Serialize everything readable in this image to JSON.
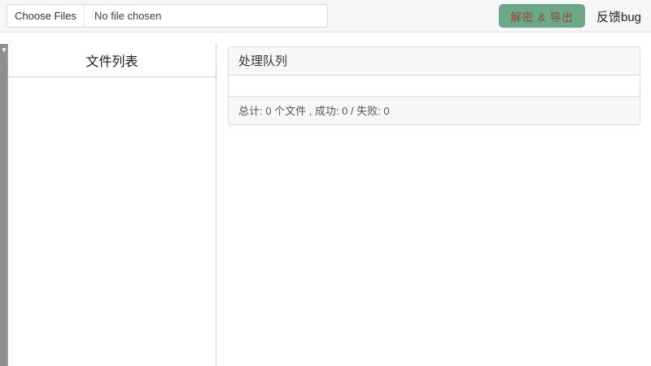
{
  "header": {
    "file_input": {
      "button_label": "Choose Files",
      "status_text": "No file chosen"
    },
    "decrypt_button_label": "解密 & 导出",
    "feedback_link_label": "反馈bug"
  },
  "file_list_panel": {
    "title": "文件列表"
  },
  "queue_panel": {
    "title": "处理队列",
    "summary": "总计: 0 个文件 , 成功: 0 / 失败: 0",
    "counts": {
      "total": 0,
      "success": 0,
      "failed": 0
    }
  },
  "icons": {
    "scrollbar_down_arrow": "▼"
  },
  "colors": {
    "accent_green": "#69a987",
    "button_text_red": "#9e4037",
    "topbar_bg": "#f4f6f8",
    "panel_header_bg": "#f7f7f7",
    "border": "#dddddd",
    "scrollbar_gray": "#8f8f8f"
  }
}
